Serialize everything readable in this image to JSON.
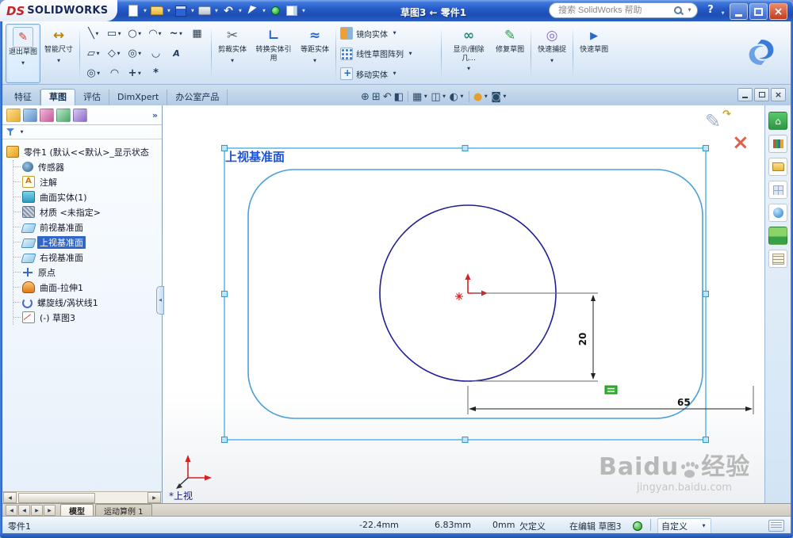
{
  "titlebar": {
    "brand_ds": "DS",
    "brand_name": "SOLIDWORKS",
    "doc_title": "草图3 ← 零件1",
    "search_text": "搜索 SolidWorks 帮助",
    "help_label": "?"
  },
  "ribbon": {
    "exit_sketch": "退出草图",
    "smart_dimension": "智能尺寸",
    "trim_entities": "剪裁实体",
    "convert_entities": "转换实体引用",
    "offset_entities": "等距实体",
    "mirror_entities": "镜向实体",
    "linear_pattern": "线性草图阵列",
    "move_entities": "移动实体",
    "display_delete_relations": "显示/删除几...",
    "repair_sketch": "修复草图",
    "quick_snaps": "快速捕捉",
    "rapid_sketch": "快速草图"
  },
  "tabs": {
    "features": "特征",
    "sketch": "草图",
    "evaluate": "评估",
    "dimxpert": "DimXpert",
    "office": "办公室产品"
  },
  "tree": {
    "root_label": "零件1 (默认<<默认>_显示状态",
    "items": [
      {
        "label": "传感器"
      },
      {
        "label": "注解"
      },
      {
        "label": "曲面实体(1)"
      },
      {
        "label": "材质 <未指定>"
      },
      {
        "label": "前视基准面"
      },
      {
        "label": "上视基准面"
      },
      {
        "label": "右视基准面"
      },
      {
        "label": "原点"
      },
      {
        "label": "曲面-拉伸1"
      },
      {
        "label": "螺旋线/涡状线1"
      },
      {
        "label": "(-) 草图3"
      }
    ]
  },
  "viewport": {
    "plane_label": "上视基准面",
    "dim_vertical": "20",
    "dim_horizontal": "65",
    "triad_label": "*上视"
  },
  "watermark": {
    "brand": "Baidu",
    "brand_cn": "经验",
    "url": "jingyan.baidu.com"
  },
  "bottom_tabs": {
    "model": "模型",
    "motion": "运动算例 1"
  },
  "statusbar": {
    "part_name": "零件1",
    "coord_x": "-22.4mm",
    "coord_y": "6.83mm",
    "coord_z": "0mm",
    "state": "欠定义",
    "editing": "在编辑 草图3",
    "custom": "自定义"
  }
}
